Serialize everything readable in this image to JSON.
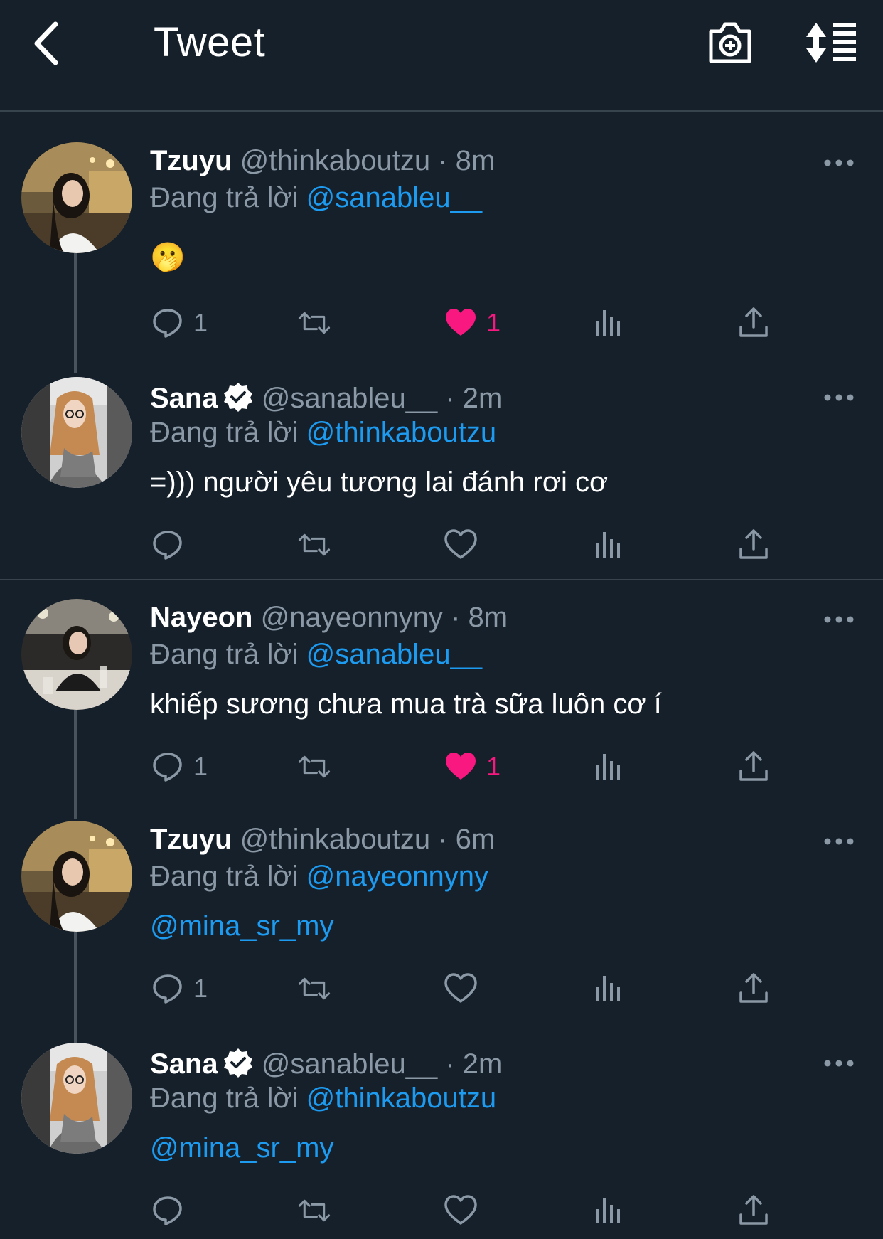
{
  "header": {
    "title": "Tweet",
    "back_icon": "chevron-left-icon",
    "camera_icon": "camera-add-icon",
    "sort_icon": "sort-icon"
  },
  "colors": {
    "background": "#15202b",
    "divider": "#38444d",
    "muted": "#8b98a5",
    "link": "#1d9bf0",
    "like": "#f91880"
  },
  "tweets": [
    {
      "name": "Tzuyu",
      "verified": false,
      "handle": "@thinkaboutzu",
      "time": "· 8m",
      "reply_prefix": "Đang trả lời ",
      "reply_to": "@sanableu__",
      "text": "🫢",
      "text_is_link": false,
      "reply_count": "1",
      "liked": true,
      "like_count": "1"
    },
    {
      "name": "Sana",
      "verified": true,
      "handle": "@sanableu__",
      "time": "· 2m",
      "reply_prefix": "Đang trả lời ",
      "reply_to": "@thinkaboutzu",
      "text": "=))) người yêu tương lai đánh rơi cơ",
      "text_is_link": false,
      "reply_count": "",
      "liked": false,
      "like_count": ""
    },
    {
      "name": "Nayeon",
      "verified": false,
      "handle": "@nayeonnyny",
      "time": "· 8m",
      "reply_prefix": "Đang trả lời ",
      "reply_to": "@sanableu__",
      "text": "khiếp sương chưa mua trà sữa luôn cơ í",
      "text_is_link": false,
      "reply_count": "1",
      "liked": true,
      "like_count": "1"
    },
    {
      "name": "Tzuyu",
      "verified": false,
      "handle": "@thinkaboutzu",
      "time": "· 6m",
      "reply_prefix": "Đang trả lời ",
      "reply_to": "@nayeonnyny",
      "text": "@mina_sr_my",
      "text_is_link": true,
      "reply_count": "1",
      "liked": false,
      "like_count": ""
    },
    {
      "name": "Sana",
      "verified": true,
      "handle": "@sanableu__",
      "time": "· 2m",
      "reply_prefix": "Đang trả lời ",
      "reply_to": "@thinkaboutzu",
      "text": "@mina_sr_my",
      "text_is_link": true,
      "reply_count": "",
      "liked": false,
      "like_count": ""
    }
  ]
}
